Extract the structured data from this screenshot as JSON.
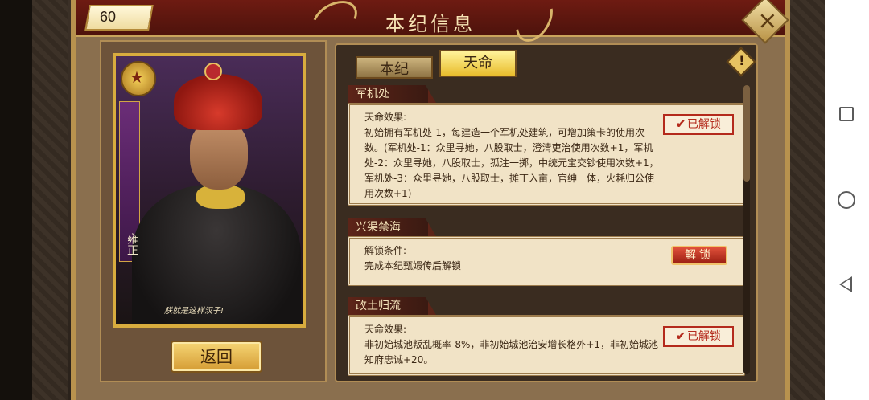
{
  "header": {
    "title": "本纪信息",
    "level": "60"
  },
  "tabs": [
    {
      "label": "本纪"
    },
    {
      "label": "天命"
    }
  ],
  "portrait": {
    "caption": "朕就是这样汉子!",
    "vertical_name": "雍正"
  },
  "back_button": "返回",
  "sections": [
    {
      "title": "军机处",
      "label": "天命效果:",
      "text": "初始拥有军机处-1，每建造一个军机处建筑，可增加策卡的使用次数。(军机处-1：众里寻她，八股取士，澄清吏治使用次数+1，军机处-2：众里寻她，八股取士，孤注一掷，中统元宝交钞使用次数+1，军机处-3：众里寻她，八股取士，摊丁入亩，官绅一体，火耗归公使用次数+1)",
      "status": "已解锁"
    },
    {
      "title": "兴渠禁海",
      "label": "解锁条件:",
      "text": "完成本纪甄嬛传后解锁",
      "button": "解锁"
    },
    {
      "title": "改土归流",
      "label": "天命效果:",
      "text": "非初始城池叛乱概率-8%，非初始城池治安增长格外+1，非初始城池知府忠诚+20。",
      "status": "已解锁"
    }
  ],
  "icons": {
    "close": "close-icon",
    "warning": "warning-icon",
    "emblem": "dragon-emblem-icon",
    "nav_recents": "square-icon",
    "nav_home": "circle-icon",
    "nav_back": "triangle-back-icon"
  },
  "colors": {
    "header_red": "#6e1b12",
    "gold": "#d8ac3e",
    "parchment": "#f1e3c6",
    "stamp_red": "#b42a1c"
  }
}
